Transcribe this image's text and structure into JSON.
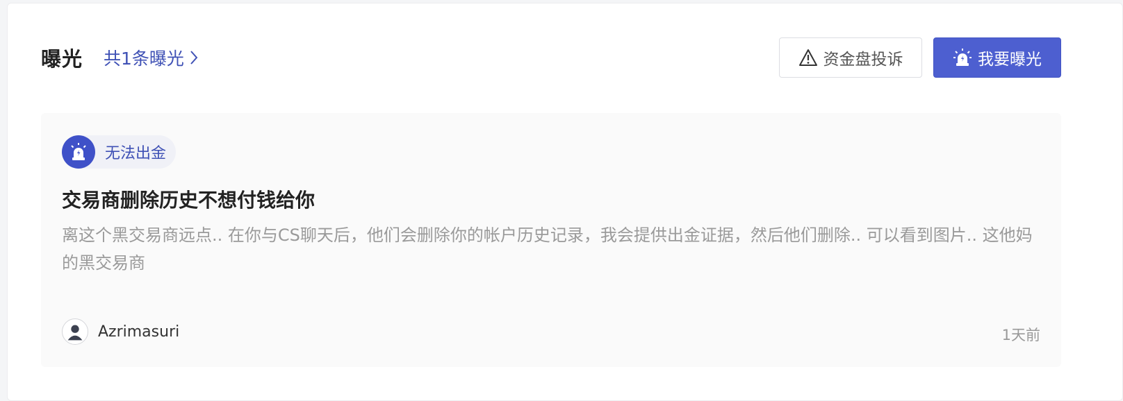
{
  "header": {
    "title": "曝光",
    "count_link": "共1条曝光"
  },
  "actions": {
    "complaint_label": "资金盘投诉",
    "expose_label": "我要曝光"
  },
  "post": {
    "tag": "无法出金",
    "title": "交易商删除历史不想付钱给你",
    "body": "离这个黑交易商远点.. 在你与CS聊天后，他们会删除你的帐户历史记录，我会提供出金证据，然后他们删除.. 可以看到图片.. 这他妈的黑交易商",
    "author": "Azrimasuri",
    "time": "1天前"
  },
  "colors": {
    "accent": "#3f51b5",
    "primary_button": "#4d5fd0"
  },
  "icons": {
    "chevron": "chevron-right-icon",
    "warning": "warning-triangle-icon",
    "alarm": "alarm-light-icon",
    "avatar": "user-avatar-icon"
  }
}
